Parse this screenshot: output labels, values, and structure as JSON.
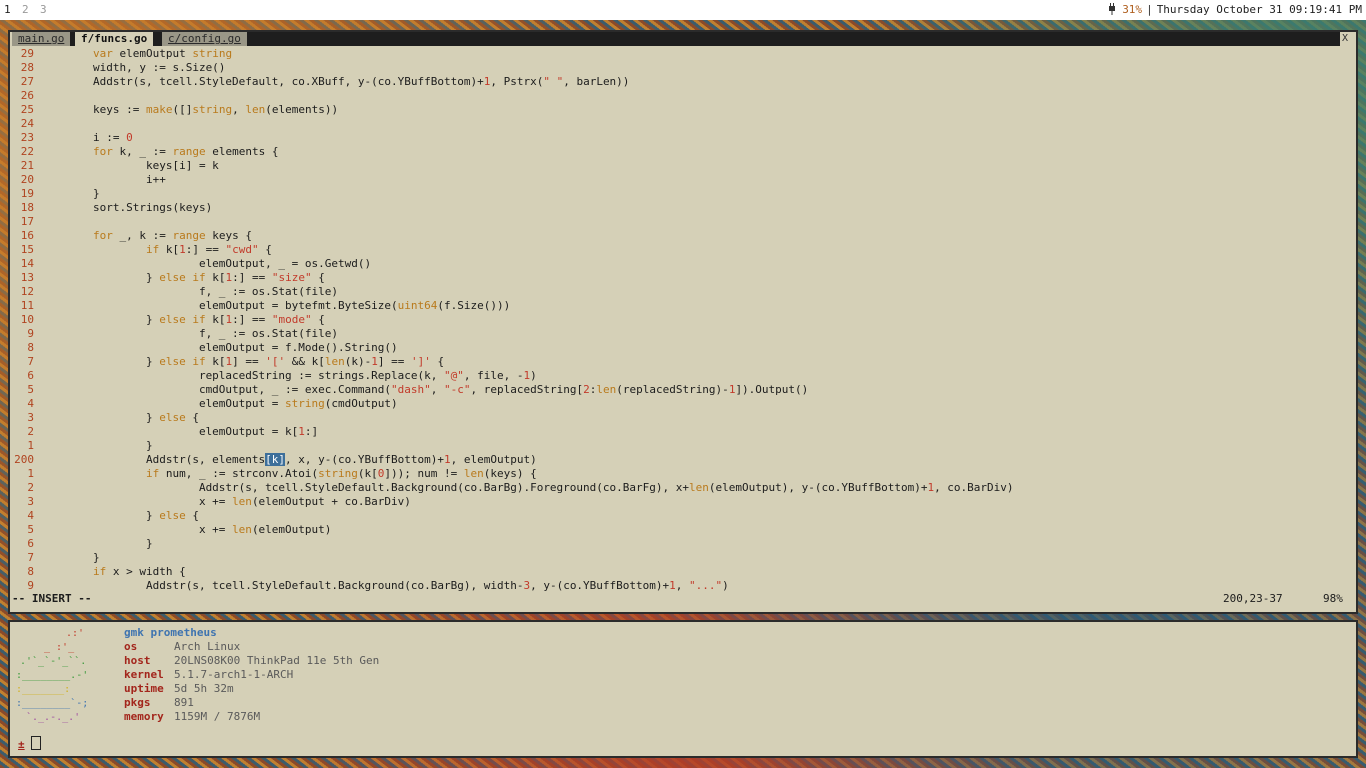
{
  "topbar": {
    "workspaces": [
      "1",
      "2",
      "3"
    ],
    "battery": "31%",
    "datetime": "Thursday October 31 09:19:41 PM"
  },
  "editor": {
    "tabs": [
      "main.go",
      "f/funcs.go",
      "c/config.go"
    ],
    "active_tab": 1,
    "close_symbol": "X",
    "mode": "-- INSERT --",
    "position": "200,23-37",
    "scroll_percent": "98%",
    "lines": [
      {
        "n": "29",
        "t": "        var elemOutput string"
      },
      {
        "n": "28",
        "t": "        width, y := s.Size()"
      },
      {
        "n": "27",
        "t": "        Addstr(s, tcell.StyleDefault, co.XBuff, y-(co.YBuffBottom)+1, Pstrx(\" \", barLen))"
      },
      {
        "n": "26",
        "t": ""
      },
      {
        "n": "25",
        "t": "        keys := make([]string, len(elements))"
      },
      {
        "n": "24",
        "t": ""
      },
      {
        "n": "23",
        "t": "        i := 0"
      },
      {
        "n": "22",
        "t": "        for k, _ := range elements {"
      },
      {
        "n": "21",
        "t": "                keys[i] = k"
      },
      {
        "n": "20",
        "t": "                i++"
      },
      {
        "n": "19",
        "t": "        }"
      },
      {
        "n": "18",
        "t": "        sort.Strings(keys)"
      },
      {
        "n": "17",
        "t": ""
      },
      {
        "n": "16",
        "t": "        for _, k := range keys {"
      },
      {
        "n": "15",
        "t": "                if k[1:] == \"cwd\" {"
      },
      {
        "n": "14",
        "t": "                        elemOutput, _ = os.Getwd()"
      },
      {
        "n": "13",
        "t": "                } else if k[1:] == \"size\" {"
      },
      {
        "n": "12",
        "t": "                        f, _ := os.Stat(file)"
      },
      {
        "n": "11",
        "t": "                        elemOutput = bytefmt.ByteSize(uint64(f.Size()))"
      },
      {
        "n": "10",
        "t": "                } else if k[1:] == \"mode\" {"
      },
      {
        "n": "9",
        "t": "                        f, _ := os.Stat(file)"
      },
      {
        "n": "8",
        "t": "                        elemOutput = f.Mode().String()"
      },
      {
        "n": "7",
        "t": "                } else if k[1] == '[' && k[len(k)-1] == ']' {"
      },
      {
        "n": "6",
        "t": "                        replacedString := strings.Replace(k, \"@\", file, -1)"
      },
      {
        "n": "5",
        "t": "                        cmdOutput, _ := exec.Command(\"dash\", \"-c\", replacedString[2:len(replacedString)-1]).Output()"
      },
      {
        "n": "4",
        "t": "                        elemOutput = string(cmdOutput)"
      },
      {
        "n": "3",
        "t": "                } else {"
      },
      {
        "n": "2",
        "t": "                        elemOutput = k[1:]"
      },
      {
        "n": "1",
        "t": "                }"
      },
      {
        "n": "200",
        "t": "                Addstr(s, elements[k], x, y-(co.YBuffBottom)+1, elemOutput)"
      },
      {
        "n": "1",
        "t": "                if num, _ := strconv.Atoi(string(k[0])); num != len(keys) {"
      },
      {
        "n": "2",
        "t": "                        Addstr(s, tcell.StyleDefault.Background(co.BarBg).Foreground(co.BarFg), x+len(elemOutput), y-(co.YBuffBottom)+1, co.BarDiv)"
      },
      {
        "n": "3",
        "t": "                        x += len(elemOutput + co.BarDiv)"
      },
      {
        "n": "4",
        "t": "                } else {"
      },
      {
        "n": "5",
        "t": "                        x += len(elemOutput)"
      },
      {
        "n": "6",
        "t": "                }"
      },
      {
        "n": "7",
        "t": "        }"
      },
      {
        "n": "8",
        "t": "        if x > width {"
      },
      {
        "n": "9",
        "t": "                Addstr(s, tcell.StyleDefault.Background(co.BarBg), width-3, y-(co.YBuffBottom)+1, \"...\")"
      }
    ]
  },
  "shell": {
    "header": "gmk prometheus",
    "info": [
      {
        "key": "os",
        "value": "Arch Linux"
      },
      {
        "key": "host",
        "value": "20LNS08K00 ThinkPad 11e 5th Gen"
      },
      {
        "key": "kernel",
        "value": "5.1.7-arch1-1-ARCH"
      },
      {
        "key": "uptime",
        "value": "5d 5h 32m"
      },
      {
        "key": "pkgs",
        "value": "891"
      },
      {
        "key": "memory",
        "value": "1159M / 7876M"
      }
    ],
    "prompt_symbol": "±"
  },
  "colors": {
    "terminal_bg": "#d5d0b7",
    "keyword": "#b97a1c",
    "string": "#c23a2a",
    "line_number": "#b0431f",
    "fetch_key": "#a3261c",
    "fetch_header": "#3f74b0"
  }
}
